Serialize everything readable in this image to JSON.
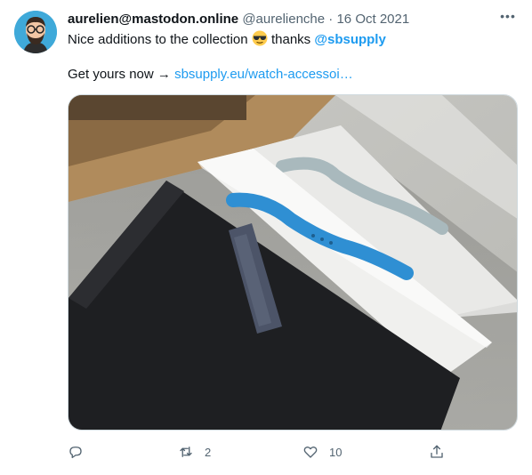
{
  "tweet": {
    "display_name": "aurelien@mastodon.online",
    "handle": "@aurelienche",
    "separator": "·",
    "date": "16 Oct 2021",
    "more_label": "•••",
    "text": {
      "line1_before": "Nice additions to the collection",
      "line1_after": "thanks",
      "mention": "@sbsupply",
      "line2_before": "Get yours now →",
      "link": "sbsupply.eu/watch-accessoi…"
    },
    "retweets": "2",
    "likes": "10"
  },
  "icons": [
    "avatar",
    "more-icon",
    "sunglasses-emoji",
    "reply-icon",
    "retweet-icon",
    "like-icon",
    "share-icon"
  ],
  "colors": {
    "accent": "#1d9bf0",
    "secondary_text": "#536471",
    "primary_text": "#0f1419"
  }
}
